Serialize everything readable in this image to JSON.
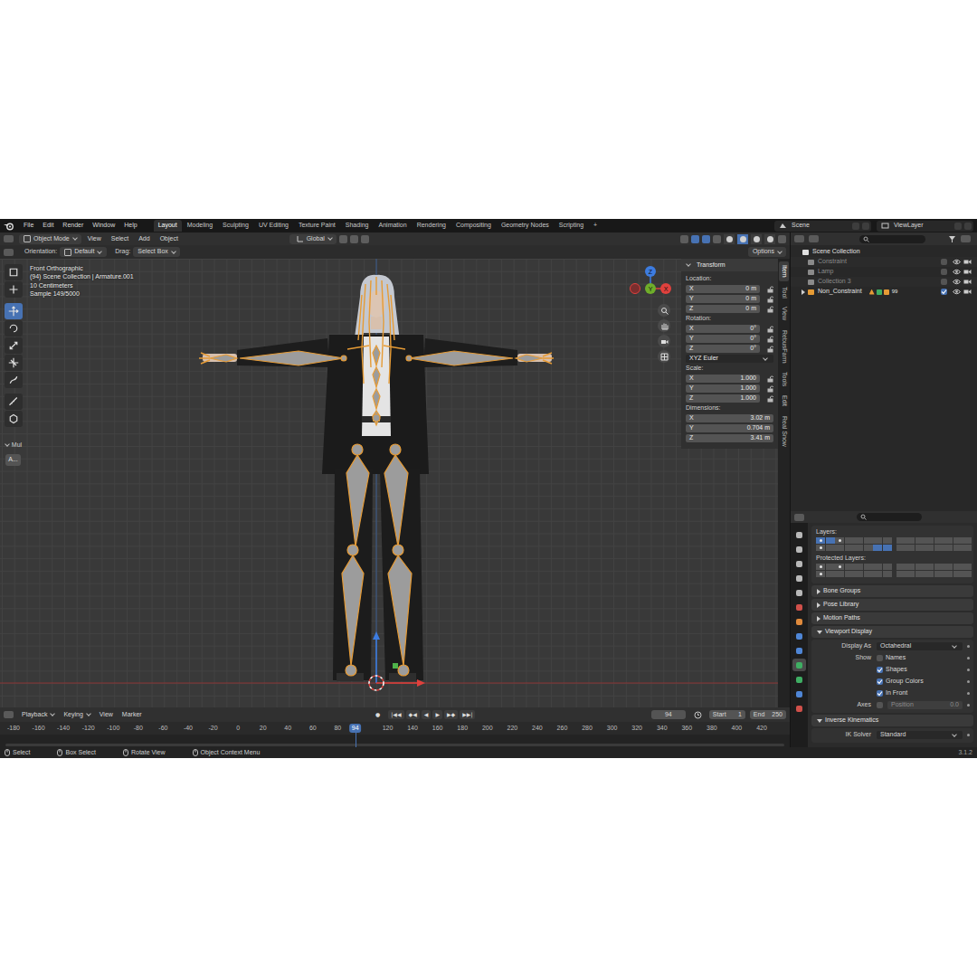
{
  "topbar": {
    "menus": [
      "File",
      "Edit",
      "Render",
      "Window",
      "Help"
    ],
    "workspaces": [
      {
        "label": "Layout",
        "selected": true
      },
      {
        "label": "Modeling",
        "selected": false
      },
      {
        "label": "Sculpting",
        "selected": false
      },
      {
        "label": "UV Editing",
        "selected": false
      },
      {
        "label": "Texture Paint",
        "selected": false
      },
      {
        "label": "Shading",
        "selected": false
      },
      {
        "label": "Animation",
        "selected": false
      },
      {
        "label": "Rendering",
        "selected": false
      },
      {
        "label": "Compositing",
        "selected": false
      },
      {
        "label": "Geometry Nodes",
        "selected": false
      },
      {
        "label": "Scripting",
        "selected": false
      }
    ],
    "add_workspace": "+",
    "scene": "Scene",
    "view_layer": "ViewLayer"
  },
  "header": {
    "mode": "Object Mode",
    "menus": [
      "View",
      "Select",
      "Add",
      "Object"
    ],
    "orientation": "Global",
    "shading": [
      {
        "selected": false
      },
      {
        "selected": true
      },
      {
        "selected": false
      },
      {
        "selected": false
      }
    ]
  },
  "tool_settings": {
    "orientation_label": "Orientation:",
    "orientation": "Default",
    "drag_label": "Drag:",
    "drag": "Select Box",
    "options": "Options"
  },
  "toolbar": {
    "tools": [
      {
        "selected": false
      },
      {
        "selected": false
      },
      {
        "selected": true
      },
      {
        "selected": false
      },
      {
        "selected": false
      },
      {
        "selected": false
      },
      {
        "selected": false
      },
      {
        "selected": false
      },
      {
        "selected": false
      }
    ],
    "mode_label": "Mul",
    "button": "A..."
  },
  "viewport": {
    "overlay": [
      "Front Orthographic",
      "(94) Scene Collection | Armature.001",
      "10 Centimeters",
      "Sample 149/5000"
    ],
    "gizmo": {
      "x": "X",
      "y": "Y",
      "z": "Z"
    }
  },
  "sidebar": {
    "title": "Transform",
    "location_label": "Location:",
    "location": [
      {
        "axis": "X",
        "value": "0 m",
        "locked": false
      },
      {
        "axis": "Y",
        "value": "0 m",
        "locked": false
      },
      {
        "axis": "Z",
        "value": "0 m",
        "locked": false
      }
    ],
    "rotation_label": "Rotation:",
    "rotation": [
      {
        "axis": "X",
        "value": "0°",
        "locked": false
      },
      {
        "axis": "Y",
        "value": "0°",
        "locked": false
      },
      {
        "axis": "Z",
        "value": "0°",
        "locked": false
      }
    ],
    "rotation_mode": "XYZ Euler",
    "scale_label": "Scale:",
    "scale": [
      {
        "axis": "X",
        "value": "1.000",
        "locked": false
      },
      {
        "axis": "Y",
        "value": "1.000",
        "locked": false
      },
      {
        "axis": "Z",
        "value": "1.000",
        "locked": false
      }
    ],
    "dimensions_label": "Dimensions:",
    "dimensions": [
      {
        "axis": "X",
        "value": "3.02 m"
      },
      {
        "axis": "Y",
        "value": "0.704 m"
      },
      {
        "axis": "Z",
        "value": "3.41 m"
      }
    ],
    "tabs": [
      {
        "label": "Item",
        "selected": true
      },
      {
        "label": "Tool",
        "selected": false
      },
      {
        "label": "View",
        "selected": false
      },
      {
        "label": "RebusFarm",
        "selected": false
      },
      {
        "label": "Tools",
        "selected": false
      },
      {
        "label": "Edit",
        "selected": false
      },
      {
        "label": "Real Snow",
        "selected": false
      }
    ]
  },
  "outliner": {
    "items": [
      {
        "label": "Scene Collection",
        "kind": "root",
        "checked": true,
        "expanded": true,
        "badge": ""
      },
      {
        "label": "Constraint",
        "kind": "collection",
        "checked": false,
        "expanded": false,
        "badge": ""
      },
      {
        "label": "Lamp",
        "kind": "collection",
        "checked": false,
        "expanded": false,
        "badge": ""
      },
      {
        "label": "Collection 3",
        "kind": "collection",
        "checked": false,
        "expanded": false,
        "badge": ""
      },
      {
        "label": "Non_Constraint",
        "kind": "object",
        "checked": true,
        "expanded": false,
        "badge": "99"
      }
    ]
  },
  "properties": {
    "tabs": [
      {
        "color": "#b8b8b8",
        "selected": false
      },
      {
        "color": "#b8b8b8",
        "selected": false
      },
      {
        "color": "#b8b8b8",
        "selected": false
      },
      {
        "color": "#b8b8b8",
        "selected": false
      },
      {
        "color": "#b8b8b8",
        "selected": false
      },
      {
        "color": "#d0504a",
        "selected": false
      },
      {
        "color": "#e08a3c",
        "selected": false
      },
      {
        "color": "#4f86d6",
        "selected": false
      },
      {
        "color": "#4f86d6",
        "selected": false
      },
      {
        "color": "#3fae63",
        "selected": true
      },
      {
        "color": "#3fae63",
        "selected": false
      },
      {
        "color": "#4f86d6",
        "selected": false
      },
      {
        "color": "#d0504a",
        "selected": false
      }
    ],
    "layers_label": "Layers:",
    "layers": [
      [
        {
          "selected": true,
          "used": true
        },
        {
          "selected": true,
          "used": false
        },
        {
          "selected": false,
          "used": true
        },
        {
          "selected": false,
          "used": false
        },
        {
          "selected": false,
          "used": false
        },
        {
          "selected": false,
          "used": false
        },
        {
          "selected": false,
          "used": false
        },
        {
          "selected": false,
          "used": false
        },
        {
          "selected": false,
          "used": false
        },
        {
          "selected": false,
          "used": false
        },
        {
          "selected": false,
          "used": false
        },
        {
          "selected": false,
          "used": false
        },
        {
          "selected": false,
          "used": false
        },
        {
          "selected": false,
          "used": false
        },
        {
          "selected": false,
          "used": false
        },
        {
          "selected": false,
          "used": false
        }
      ],
      [
        {
          "selected": false,
          "used": true
        },
        {
          "selected": false,
          "used": false
        },
        {
          "selected": false,
          "used": false
        },
        {
          "selected": false,
          "used": false
        },
        {
          "selected": false,
          "used": false
        },
        {
          "selected": false,
          "used": false
        },
        {
          "selected": true,
          "used": false
        },
        {
          "selected": true,
          "used": false
        },
        {
          "selected": false,
          "used": false
        },
        {
          "selected": false,
          "used": false
        },
        {
          "selected": false,
          "used": false
        },
        {
          "selected": false,
          "used": false
        },
        {
          "selected": false,
          "used": false
        },
        {
          "selected": false,
          "used": false
        },
        {
          "selected": false,
          "used": false
        },
        {
          "selected": false,
          "used": false
        }
      ]
    ],
    "protected_label": "Protected Layers:",
    "protected": [
      [
        {
          "selected": false,
          "used": true
        },
        {
          "selected": false,
          "used": false
        },
        {
          "selected": false,
          "used": true
        },
        {
          "selected": false,
          "used": false
        },
        {
          "selected": false,
          "used": false
        },
        {
          "selected": false,
          "used": false
        },
        {
          "selected": false,
          "used": false
        },
        {
          "selected": false,
          "used": false
        },
        {
          "selected": false,
          "used": false
        },
        {
          "selected": false,
          "used": false
        },
        {
          "selected": false,
          "used": false
        },
        {
          "selected": false,
          "used": false
        },
        {
          "selected": false,
          "used": false
        },
        {
          "selected": false,
          "used": false
        },
        {
          "selected": false,
          "used": false
        },
        {
          "selected": false,
          "used": false
        }
      ],
      [
        {
          "selected": false,
          "used": true
        },
        {
          "selected": false,
          "used": false
        },
        {
          "selected": false,
          "used": false
        },
        {
          "selected": false,
          "used": false
        },
        {
          "selected": false,
          "used": false
        },
        {
          "selected": false,
          "used": false
        },
        {
          "selected": false,
          "used": false
        },
        {
          "selected": false,
          "used": false
        },
        {
          "selected": false,
          "used": false
        },
        {
          "selected": false,
          "used": false
        },
        {
          "selected": false,
          "used": false
        },
        {
          "selected": false,
          "used": false
        },
        {
          "selected": false,
          "used": false
        },
        {
          "selected": false,
          "used": false
        },
        {
          "selected": false,
          "used": false
        },
        {
          "selected": false,
          "used": false
        }
      ]
    ],
    "panels": [
      {
        "label": "Bone Groups",
        "expanded": false
      },
      {
        "label": "Pose Library",
        "expanded": false
      },
      {
        "label": "Motion Paths",
        "expanded": false
      }
    ],
    "viewport_display": {
      "label": "Viewport Display",
      "expanded": true,
      "display_as_label": "Display As",
      "display_as": "Octahedral",
      "show_label": "Show",
      "show": [
        {
          "label": "Names",
          "checked": false
        },
        {
          "label": "Shapes",
          "checked": true
        },
        {
          "label": "Group Colors",
          "checked": true
        },
        {
          "label": "In Front",
          "checked": true
        }
      ],
      "axes_label": "Axes",
      "axes_checked": false,
      "position_label": "Position",
      "position": "0.0"
    },
    "ik": {
      "label": "Inverse Kinematics",
      "expanded": true,
      "solver_label": "IK Solver",
      "solver": "Standard"
    }
  },
  "timeline": {
    "menus": [
      "Playback",
      "Keying",
      "View",
      "Marker"
    ],
    "buttons": [
      "●",
      "|◀◀",
      "◆◀",
      "◀",
      "▶",
      "▶◆",
      "▶▶|"
    ],
    "frame": "94",
    "start_label": "Start",
    "start": "1",
    "end_label": "End",
    "end": "250",
    "ticks": [
      "-180",
      "-160",
      "-140",
      "-120",
      "-100",
      "-80",
      "-60",
      "-40",
      "-20",
      "0",
      "20",
      "40",
      "60",
      "80",
      "120",
      "140",
      "160",
      "180",
      "200",
      "220",
      "240",
      "260",
      "280",
      "300",
      "320",
      "340",
      "360",
      "380",
      "400",
      "420"
    ],
    "playhead": "94"
  },
  "status_bar": {
    "items": [
      "Select",
      "Box Select",
      "Rotate View",
      "Object Context Menu"
    ],
    "version": "3.1.2"
  }
}
